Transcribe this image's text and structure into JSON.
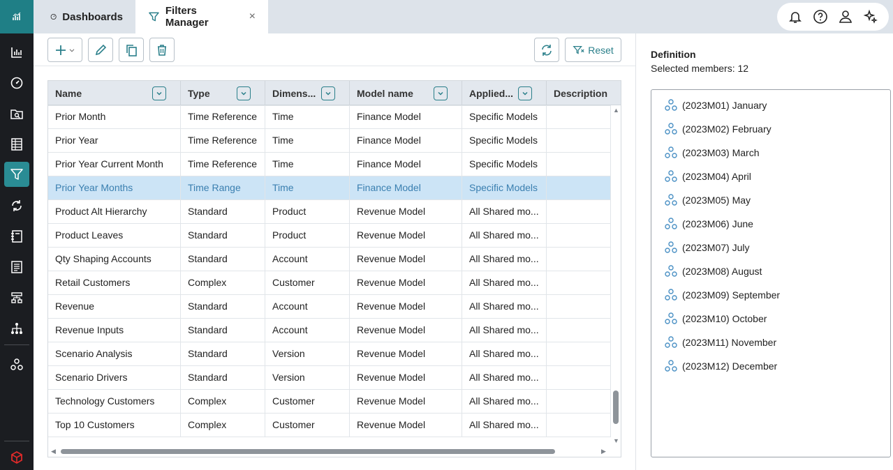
{
  "tabs": [
    {
      "label": "Dashboards",
      "icon": "gauge-icon"
    },
    {
      "label": "Filters Manager",
      "icon": "filter-icon",
      "close": "×"
    }
  ],
  "toolbar": {
    "reset_label": "Reset"
  },
  "grid": {
    "columns": [
      "Name",
      "Type",
      "Dimens...",
      "Model name",
      "Applied...",
      "Description"
    ],
    "rows": [
      [
        "Prior Month",
        "Time Reference",
        "Time",
        "Finance Model",
        "Specific Models",
        ""
      ],
      [
        "Prior Year",
        "Time Reference",
        "Time",
        "Finance Model",
        "Specific Models",
        ""
      ],
      [
        "Prior Year Current Month",
        "Time Reference",
        "Time",
        "Finance Model",
        "Specific Models",
        ""
      ],
      [
        "Prior Year Months",
        "Time Range",
        "Time",
        "Finance Model",
        "Specific Models",
        ""
      ],
      [
        "Product Alt Hierarchy",
        "Standard",
        "Product",
        "Revenue Model",
        "All Shared mo...",
        ""
      ],
      [
        "Product Leaves",
        "Standard",
        "Product",
        "Revenue Model",
        "All Shared mo...",
        ""
      ],
      [
        "Qty Shaping Accounts",
        "Standard",
        "Account",
        "Revenue Model",
        "All Shared mo...",
        ""
      ],
      [
        "Retail Customers",
        "Complex",
        "Customer",
        "Revenue Model",
        "All Shared mo...",
        ""
      ],
      [
        "Revenue",
        "Standard",
        "Account",
        "Revenue Model",
        "All Shared mo...",
        ""
      ],
      [
        "Revenue Inputs",
        "Standard",
        "Account",
        "Revenue Model",
        "All Shared mo...",
        ""
      ],
      [
        "Scenario Analysis",
        "Standard",
        "Version",
        "Revenue Model",
        "All Shared mo...",
        ""
      ],
      [
        "Scenario Drivers",
        "Standard",
        "Version",
        "Revenue Model",
        "All Shared mo...",
        ""
      ],
      [
        "Technology Customers",
        "Complex",
        "Customer",
        "Revenue Model",
        "All Shared mo...",
        ""
      ],
      [
        "Top 10 Customers",
        "Complex",
        "Customer",
        "Revenue Model",
        "All Shared mo...",
        ""
      ]
    ],
    "selected_row": "Prior Year Months"
  },
  "definition": {
    "title": "Definition",
    "selected_text": "Selected members: 12",
    "members": [
      "(2023M01) January",
      "(2023M02) February",
      "(2023M03) March",
      "(2023M04) April",
      "(2023M05) May",
      "(2023M06) June",
      "(2023M07) July",
      "(2023M08) August",
      "(2023M09) September",
      "(2023M10) October",
      "(2023M11) November",
      "(2023M12) December"
    ]
  },
  "colors": {
    "accent": "#2a7f8a",
    "rail": "#1b1d21",
    "selected_row": "#cce4f6",
    "brand": "#1f7f86"
  }
}
